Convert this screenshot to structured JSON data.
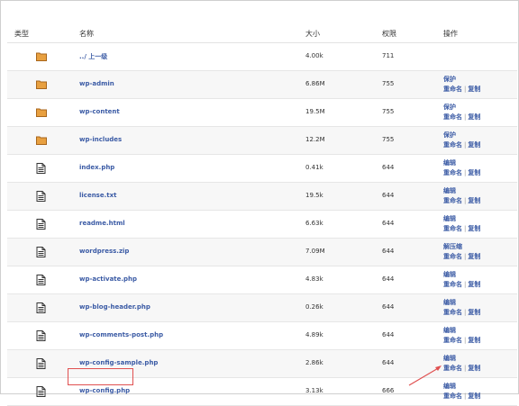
{
  "headers": {
    "type": "类型",
    "name": "名称",
    "size": "大小",
    "perm": "权限",
    "action": "操作"
  },
  "rows": [
    {
      "kind": "folder",
      "name": "../ 上一级",
      "size": "4.00k",
      "perm": "711",
      "actions": []
    },
    {
      "kind": "folder",
      "name": "wp-admin",
      "size": "6.86M",
      "perm": "755",
      "actions": [
        "保护",
        "重命名",
        "复制"
      ]
    },
    {
      "kind": "folder",
      "name": "wp-content",
      "size": "19.5M",
      "perm": "755",
      "actions": [
        "保护",
        "重命名",
        "复制"
      ]
    },
    {
      "kind": "folder",
      "name": "wp-includes",
      "size": "12.2M",
      "perm": "755",
      "actions": [
        "保护",
        "重命名",
        "复制"
      ]
    },
    {
      "kind": "file",
      "name": "index.php",
      "size": "0.41k",
      "perm": "644",
      "actions": [
        "编辑",
        "重命名",
        "复制"
      ]
    },
    {
      "kind": "file",
      "name": "license.txt",
      "size": "19.5k",
      "perm": "644",
      "actions": [
        "编辑",
        "重命名",
        "复制"
      ]
    },
    {
      "kind": "file",
      "name": "readme.html",
      "size": "6.63k",
      "perm": "644",
      "actions": [
        "编辑",
        "重命名",
        "复制"
      ]
    },
    {
      "kind": "file",
      "name": "wordpress.zip",
      "size": "7.09M",
      "perm": "644",
      "actions": [
        "解压缩",
        "重命名",
        "复制"
      ]
    },
    {
      "kind": "file",
      "name": "wp-activate.php",
      "size": "4.83k",
      "perm": "644",
      "actions": [
        "编辑",
        "重命名",
        "复制"
      ]
    },
    {
      "kind": "file",
      "name": "wp-blog-header.php",
      "size": "0.26k",
      "perm": "644",
      "actions": [
        "编辑",
        "重命名",
        "复制"
      ]
    },
    {
      "kind": "file",
      "name": "wp-comments-post.php",
      "size": "4.89k",
      "perm": "644",
      "actions": [
        "编辑",
        "重命名",
        "复制"
      ]
    },
    {
      "kind": "file",
      "name": "wp-config-sample.php",
      "size": "2.86k",
      "perm": "644",
      "actions": [
        "编辑",
        "重命名",
        "复制"
      ]
    },
    {
      "kind": "file",
      "name": "wp-config.php",
      "size": "3.13k",
      "perm": "666",
      "actions": [
        "编辑",
        "重命名",
        "复制"
      ]
    }
  ],
  "colors": {
    "link": "#3b5ba5",
    "highlight": "#e05050",
    "folder": "#e8a040"
  }
}
